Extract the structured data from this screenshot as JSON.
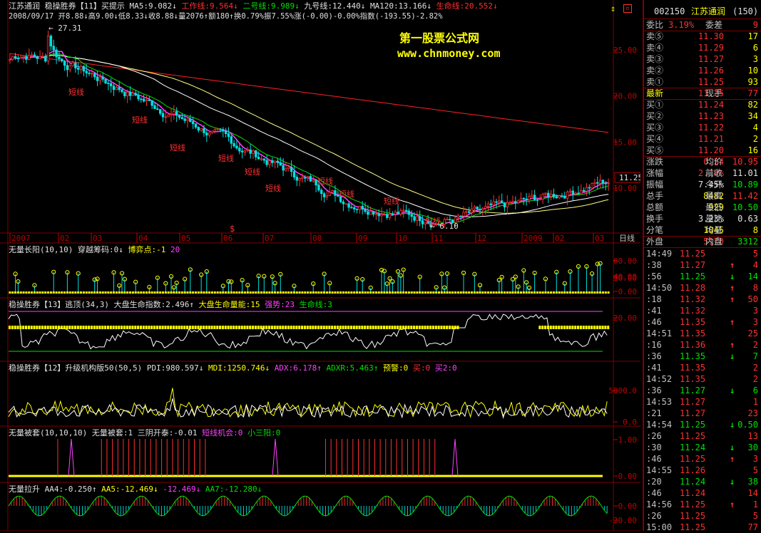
{
  "main_header": {
    "stock_name": "江苏通润",
    "indicator": "稳操胜券【11】买提示",
    "ma5": "MA5:9.082↓",
    "work_line": "工作线:9.564↓",
    "line2": "二号线:9.989↓",
    "line9": "九号线:12.440↓",
    "ma120": "MA120:13.166↓",
    "life_line": "生命线:20.552↓",
    "info": "2008/09/17 开8.88↓高9.00↓低8.33↓收8.88↓量2076↑额180↑换0.79%振7.55%涨(-0.00)-0.00%指数(-193.55)-2.82%"
  },
  "watermark": {
    "title": "第一股票公式网",
    "url": "www.chnmoney.com"
  },
  "price_axis": [
    "25.00",
    "20.00",
    "15.00",
    "10.00"
  ],
  "current_price_tag": "11.25",
  "high_label": "27.31",
  "low_label": "6.10",
  "short_labels": [
    "短线"
  ],
  "s_marker": "$",
  "date_axis": [
    "2007",
    "02",
    "03",
    "04",
    "05",
    "06",
    "07",
    "08",
    "09",
    "10",
    "11",
    "12",
    "2009",
    "02",
    "03"
  ],
  "period_label": "日线",
  "panel2": {
    "title": "无量长阳(10,10)",
    "a": "穿越筹码:0↓",
    "b": "博弈点:-1",
    "c": "20",
    "axis": [
      "60.00",
      "40.00",
      "20.00",
      "0.00"
    ]
  },
  "panel3": {
    "title": "稳操胜券【13】逃顶(34,3)",
    "a": "大盘生命指数:2.496↑",
    "b": "大盘生命量能:15",
    "c": "强势:23",
    "d": "生命线:3",
    "axis": [
      "20.00"
    ]
  },
  "panel4": {
    "title": "稳操胜券【12】升级机构版50(50,5)",
    "a": "PDI:980.597↓",
    "b": "MDI:1250.746↓",
    "c": "ADX:6.178↑",
    "d": "ADXR:5.463↑",
    "e": "预警:0",
    "f": "买:0",
    "g": "买2:0",
    "axis": [
      "5000.0",
      "0.0"
    ]
  },
  "panel5": {
    "title": "无量被套(10,10,10)",
    "a": "无量被套:1",
    "b": "三阴开泰:-0.01",
    "c": "短线机会:0",
    "d": "小三阳:0",
    "axis": [
      "1.00",
      "0.00"
    ]
  },
  "panel6": {
    "title": "无量拉升",
    "a": "AA4:-0.250↑",
    "b": "AA5:-12.469↓",
    "c": "-12.469↓",
    "d": "AA7:-12.280↓",
    "axis": [
      "0.00",
      "-20.00"
    ]
  },
  "quote": {
    "code": "002150",
    "name": "江苏通润",
    "share": "(150)",
    "ratio_label": "委比",
    "ratio": "3.19%",
    "diff_label": "委差",
    "diff": "9",
    "asks": [
      {
        "label": "卖⑤",
        "price": "11.30",
        "vol": "17"
      },
      {
        "label": "卖④",
        "price": "11.29",
        "vol": "6"
      },
      {
        "label": "卖③",
        "price": "11.27",
        "vol": "3"
      },
      {
        "label": "卖②",
        "price": "11.26",
        "vol": "10"
      },
      {
        "label": "卖①",
        "price": "11.25",
        "vol": "93"
      }
    ],
    "last_label": "最新",
    "last": "11.25",
    "hand_label": "现手",
    "hand": "77",
    "bids": [
      {
        "label": "买①",
        "price": "11.24",
        "vol": "82"
      },
      {
        "label": "买②",
        "price": "11.23",
        "vol": "34"
      },
      {
        "label": "买③",
        "price": "11.22",
        "vol": "4"
      },
      {
        "label": "买④",
        "price": "11.21",
        "vol": "2"
      },
      {
        "label": "买⑤",
        "price": "11.20",
        "vol": "16"
      }
    ],
    "stats": [
      {
        "l1": "涨跌",
        "v1": "0.24",
        "l2": "均价",
        "v2": "10.95"
      },
      {
        "l1": "涨幅",
        "v1": "2.18%",
        "l2": "前收",
        "v2": "11.01"
      },
      {
        "l1": "振幅",
        "v1": "7.45%",
        "l2": "今开",
        "v2": "10.89"
      },
      {
        "l1": "总手",
        "v1": "8482",
        "l2": "最高",
        "v2": "11.42"
      },
      {
        "l1": "总额",
        "v1": "929",
        "l2": "最低",
        "v2": "10.50"
      },
      {
        "l1": "换手",
        "v1": "3.23%",
        "l2": "量比",
        "v2": "0.63"
      },
      {
        "l1": "分笔",
        "v1": "1045",
        "l2": "均量",
        "v2": "8"
      }
    ],
    "outer_label": "外盘",
    "outer": "5170",
    "inner_label": "内盘",
    "inner": "3312"
  },
  "ticks": [
    {
      "t": "14:49",
      "p": "11.25",
      "a": "",
      "v": "5"
    },
    {
      "t": ":38",
      "p": "11.27",
      "a": "↑",
      "v": "4"
    },
    {
      "t": ":56",
      "p": "11.25",
      "a": "↓",
      "v": "14"
    },
    {
      "t": "14:50",
      "p": "11.28",
      "a": "↑",
      "v": "8"
    },
    {
      "t": ":18",
      "p": "11.32",
      "a": "↑",
      "v": "50"
    },
    {
      "t": ":41",
      "p": "11.32",
      "a": "",
      "v": "3"
    },
    {
      "t": ":46",
      "p": "11.35",
      "a": "↑",
      "v": "3"
    },
    {
      "t": "14:51",
      "p": "11.35",
      "a": "",
      "v": "25"
    },
    {
      "t": ":16",
      "p": "11.36",
      "a": "↑",
      "v": "2"
    },
    {
      "t": ":36",
      "p": "11.35",
      "a": "↓",
      "v": "7"
    },
    {
      "t": ":41",
      "p": "11.35",
      "a": "",
      "v": "2"
    },
    {
      "t": "14:52",
      "p": "11.35",
      "a": "",
      "v": "2"
    },
    {
      "t": ":36",
      "p": "11.27",
      "a": "↓",
      "v": "6"
    },
    {
      "t": "14:53",
      "p": "11.27",
      "a": "",
      "v": "1"
    },
    {
      "t": ":21",
      "p": "11.27",
      "a": "",
      "v": "23"
    },
    {
      "t": "14:54",
      "p": "11.25",
      "a": "↓",
      "v": "0.50"
    },
    {
      "t": ":26",
      "p": "11.25",
      "a": "",
      "v": "13"
    },
    {
      "t": ":30",
      "p": "11.24",
      "a": "↓",
      "v": "30"
    },
    {
      "t": ":46",
      "p": "11.25",
      "a": "↑",
      "v": "3"
    },
    {
      "t": "14:55",
      "p": "11.26",
      "a": "",
      "v": "5"
    },
    {
      "t": ":20",
      "p": "11.24",
      "a": "↓",
      "v": "38"
    },
    {
      "t": ":46",
      "p": "11.24",
      "a": "",
      "v": "14"
    },
    {
      "t": "14:56",
      "p": "11.25",
      "a": "↑",
      "v": "1"
    },
    {
      "t": ":26",
      "p": "11.25",
      "a": "",
      "v": "5"
    },
    {
      "t": "15:00",
      "p": "11.25",
      "a": "",
      "v": "77"
    }
  ],
  "colors": {
    "up": "#ff3030",
    "down": "#00e0e0",
    "yellow": "#ffff00",
    "magenta": "#ff40ff",
    "green": "#00e000",
    "border": "#800000"
  }
}
